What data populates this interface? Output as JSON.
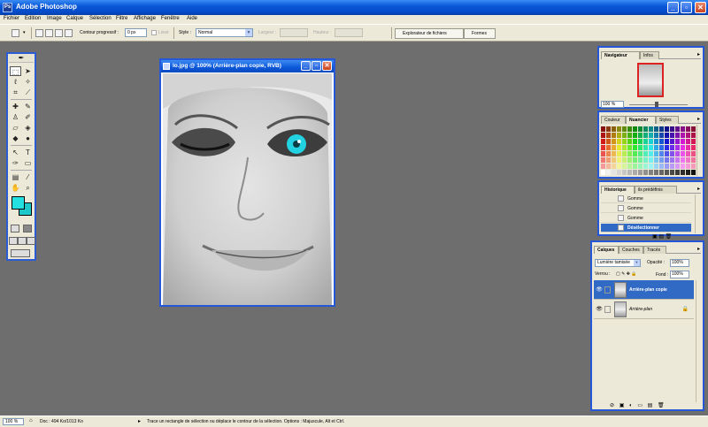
{
  "app": {
    "title": "Adobe Photoshop",
    "icon_label": "Ps"
  },
  "menu": [
    "Fichier",
    "Edition",
    "Image",
    "Calque",
    "Sélection",
    "Filtre",
    "Affichage",
    "Fenêtre",
    "Aide"
  ],
  "options": {
    "feather_label": "Contour progressif :",
    "feather_value": "0 px",
    "antialias_label": "Lissé",
    "style_label": "Style :",
    "style_value": "Normal",
    "width_label": "Largeur :",
    "height_label": "Hauteur :",
    "tabs": [
      "Explorateur de fichiers",
      "Formes"
    ]
  },
  "document": {
    "title": "lo.jpg @ 100% (Arrière-plan copie, RVB)"
  },
  "toolbox": {
    "fg_color": "#25e0e0",
    "bg_color": "#1dc8c8"
  },
  "navigator": {
    "tabs": [
      "Navigateur",
      "Infos"
    ],
    "zoom": "100 %"
  },
  "color_panel": {
    "tabs": [
      "Couleur",
      "Nuancier",
      "Styles"
    ]
  },
  "history": {
    "tabs": [
      "Historique",
      "Outils prédéfinis"
    ],
    "tab2_visible": "ils prédéfinis",
    "rows": [
      {
        "label": "Gomme",
        "selected": false
      },
      {
        "label": "Gomme",
        "selected": false
      },
      {
        "label": "Gomme",
        "selected": false
      },
      {
        "label": "Désélectionner",
        "selected": true
      }
    ]
  },
  "layers": {
    "tabs": [
      "Calques",
      "Couches",
      "Tracés"
    ],
    "blend_mode": "Lumière tamisée",
    "opacity_label": "Opacité :",
    "opacity_value": "100%",
    "lock_label": "Verrou :",
    "fill_label": "Fond :",
    "fill_value": "100%",
    "rows": [
      {
        "name": "Arrière-plan copie",
        "selected": true
      },
      {
        "name": "Arrière-plan",
        "selected": false
      }
    ]
  },
  "status": {
    "zoom": "100 %",
    "doc": "Doc : 494 Ko/1013 Ko",
    "message": "Trace un rectangle de sélection ou déplace le contour de la sélection. Options : Majuscule, Alt et Ctrl."
  }
}
